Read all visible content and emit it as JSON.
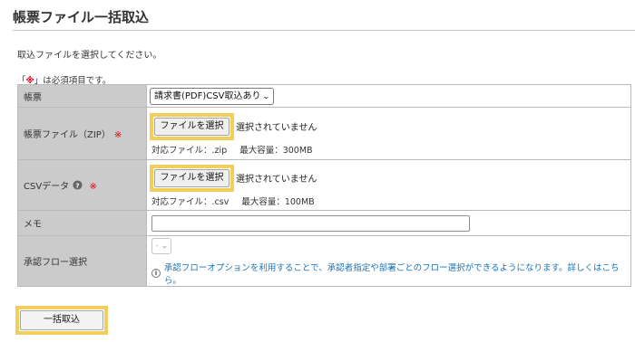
{
  "page": {
    "title": "帳票ファイル一括取込",
    "instruction": "取込ファイルを選択してください。",
    "required_note_prefix": "「",
    "required_mark": "※",
    "required_note_suffix": "」は必須項目です。"
  },
  "form": {
    "rows": [
      {
        "label": "帳票",
        "select_value": "請求書(PDF)CSV取込あり"
      },
      {
        "label": "帳票ファイル（ZIP）",
        "required": "※",
        "button": "ファイルを選択",
        "status": "選択されていません",
        "spec_type": "対応ファイル：.zip",
        "spec_size": "最大容量：300MB"
      },
      {
        "label": "CSVデータ",
        "help_icon": "question-circle-icon",
        "required": "※",
        "button": "ファイルを選択",
        "status": "選択されていません",
        "spec_type": "対応ファイル：.csv",
        "spec_size": "最大容量：100MB"
      },
      {
        "label": "メモ",
        "value": ""
      },
      {
        "label": "承認フロー選択",
        "select_value": "-",
        "info": "承認フローオプションを利用することで、承認者指定や部署ごとのフロー選択ができるようになります。詳しくはこちら。"
      }
    ]
  },
  "actions": {
    "submit_label": "一括取込"
  },
  "colors": {
    "label_bg": "#cbcbcb",
    "highlight": "#f2cf5b",
    "required": "#e60012",
    "link": "#1a73b8"
  }
}
